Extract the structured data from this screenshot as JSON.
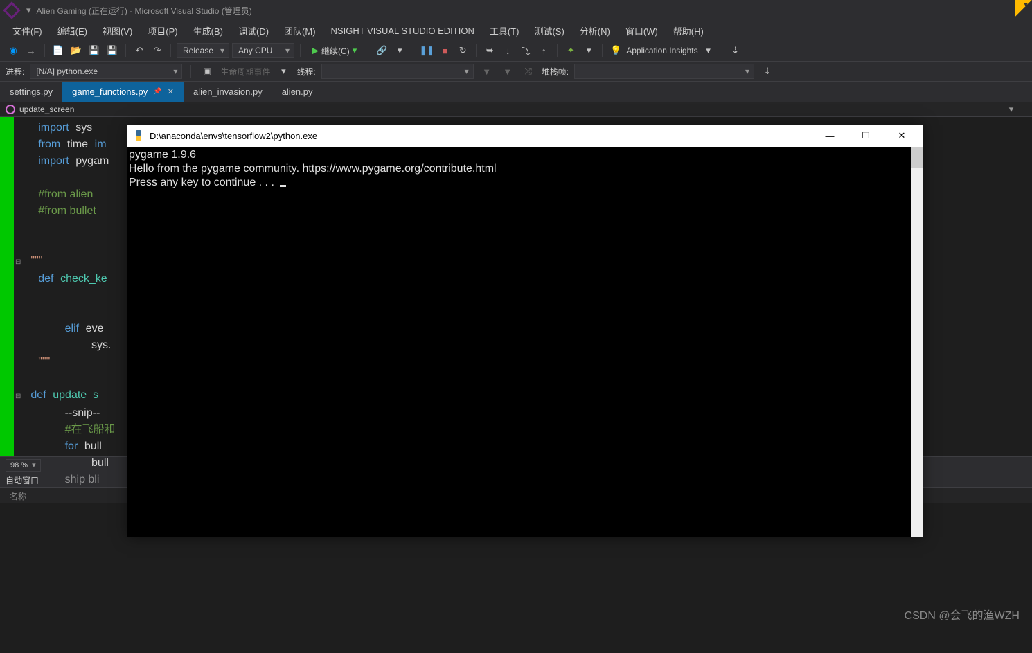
{
  "titlebar": {
    "title": "Alien Gaming (正在运行) - Microsoft Visual Studio (管理员)"
  },
  "menu": {
    "file": "文件(F)",
    "edit": "编辑(E)",
    "view": "视图(V)",
    "project": "项目(P)",
    "build": "生成(B)",
    "debug": "调试(D)",
    "team": "团队(M)",
    "nsight": "NSIGHT VISUAL STUDIO EDITION",
    "tools": "工具(T)",
    "test": "测试(S)",
    "analyze": "分析(N)",
    "window": "窗口(W)",
    "help": "帮助(H)"
  },
  "toolbar": {
    "config": "Release",
    "platform": "Any CPU",
    "continue": "继续(C)",
    "insights": "Application Insights"
  },
  "debugbar": {
    "process_label": "进程:",
    "process_value": "[N/A] python.exe",
    "lifecycle": "生命周期事件",
    "thread_label": "线程:",
    "stackframe_label": "堆栈帧:"
  },
  "tabs": {
    "t0": "settings.py",
    "t1": "game_functions.py",
    "t2": "alien_invasion.py",
    "t3": "alien.py"
  },
  "nav": {
    "member": "update_screen"
  },
  "code": {
    "l1_kw": "import",
    "l1_id": "sys",
    "l2_kw": "from",
    "l2_id": "time",
    "l2_kw2": "im",
    "l3_kw": "import",
    "l3_id": "pygam",
    "l4": "#from alien",
    "l5": "#from bullet",
    "l6": "\"\"\"",
    "l7_kw": "def",
    "l7_fn": "check_ke",
    "l8_kw": "elif",
    "l8_id": "eve",
    "l9": "sys.",
    "l10": "\"\"\"",
    "l11_kw": "def",
    "l11_fn": "update_s",
    "l12": "--snip--",
    "l13": "#在飞船和",
    "l14_kw": "for",
    "l14_id": "bull",
    "l15": "bull",
    "l16": "ship bli"
  },
  "zoom": {
    "value": "98 %"
  },
  "auto": {
    "title": "自动窗口",
    "col0": "名称"
  },
  "console": {
    "title": "D:\\anaconda\\envs\\tensorflow2\\python.exe",
    "line1": "pygame 1.9.6",
    "line2": "Hello from the pygame community. https://www.pygame.org/contribute.html",
    "line3": "Press any key to continue . . . "
  },
  "watermark": "CSDN @会飞的渔WZH"
}
